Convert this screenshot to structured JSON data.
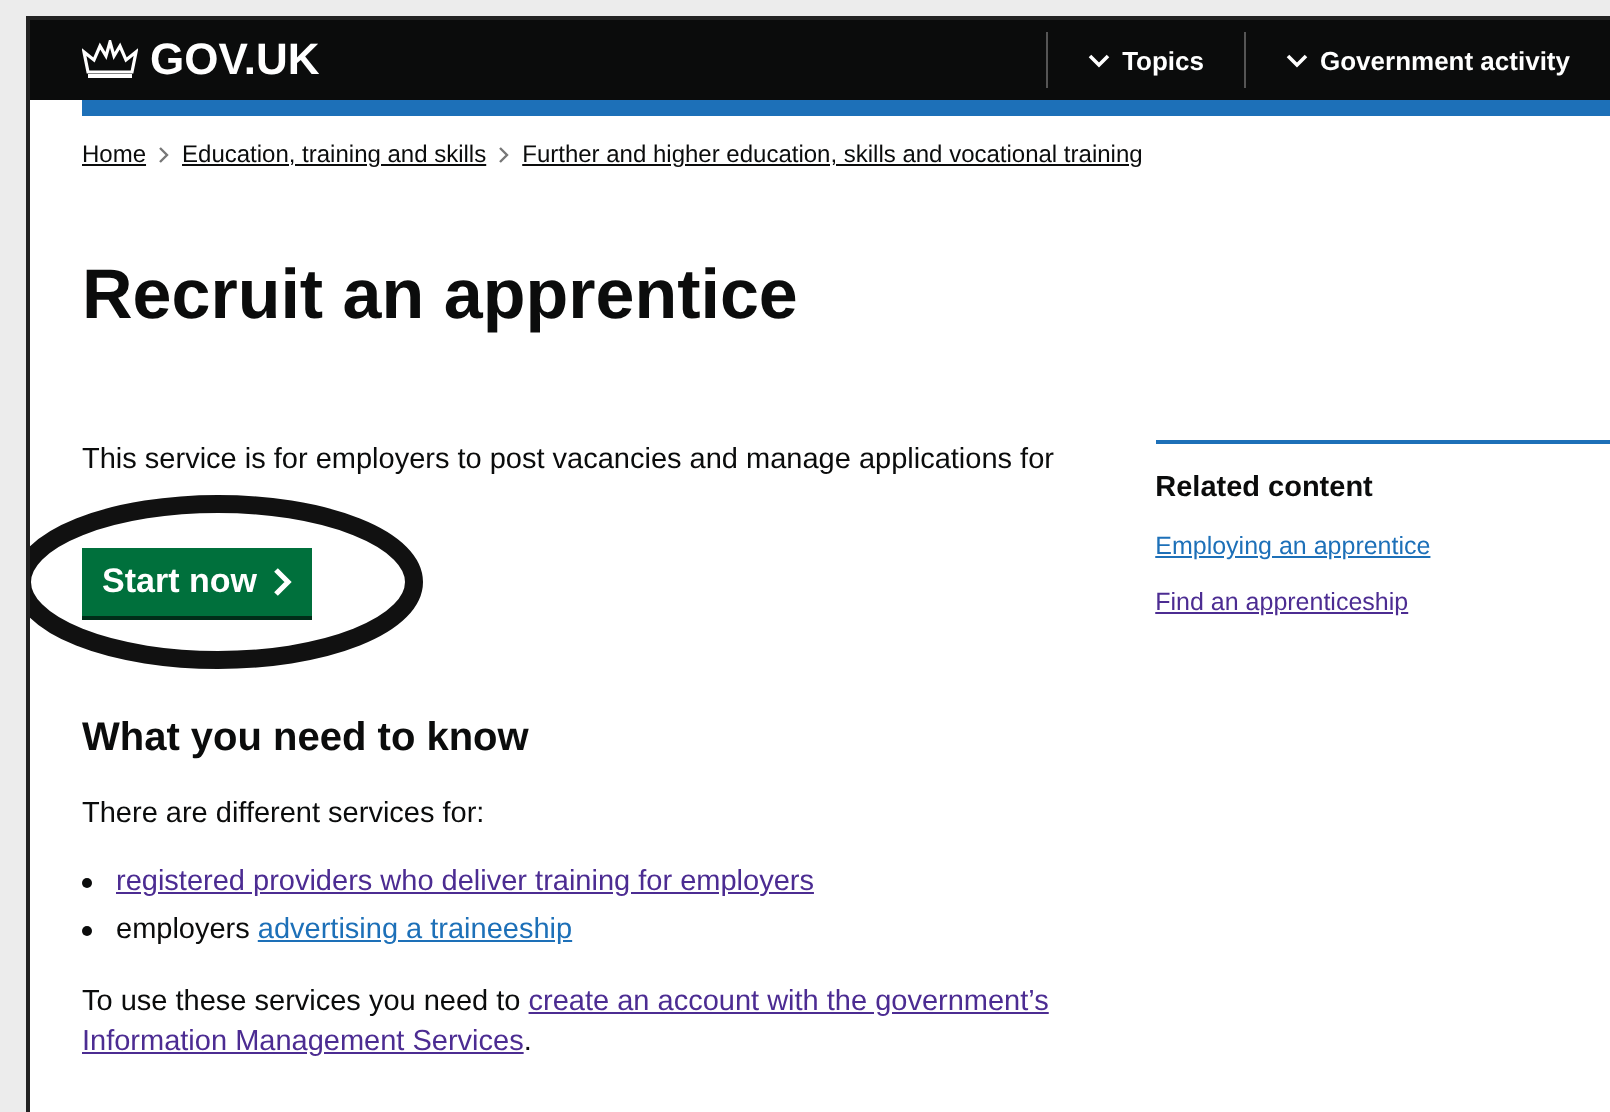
{
  "header": {
    "logo": "GOV.UK",
    "nav": [
      {
        "label": "Topics",
        "expanded": false
      },
      {
        "label": "Government activity",
        "expanded": false
      }
    ]
  },
  "breadcrumbs": [
    "Home",
    "Education, training and skills",
    "Further and higher education, skills and vocational training"
  ],
  "title": "Recruit an apprentice",
  "intro": "This service is for employers to post vacancies and manage applications for",
  "start_button": "Start now",
  "section_heading": "What you need to know",
  "lead": "There are different services for:",
  "list": [
    {
      "link": "registered providers who deliver training for employers",
      "visited": true
    },
    {
      "text": "employers ",
      "link": "advertising a traineeship",
      "visited": false
    }
  ],
  "note": {
    "text": "To use these services you need to ",
    "links": [
      {
        "label": "create an account with the government’s",
        "visited": true
      },
      {
        "label": "Information Management Services",
        "visited": true
      }
    ],
    "end": "."
  },
  "related": {
    "heading": "Related content",
    "links": [
      {
        "label": "Employing an apprentice",
        "visited": false
      },
      {
        "label": "Find an apprenticeship",
        "visited": true
      }
    ]
  },
  "annotation": {
    "kind": "ellipse"
  }
}
